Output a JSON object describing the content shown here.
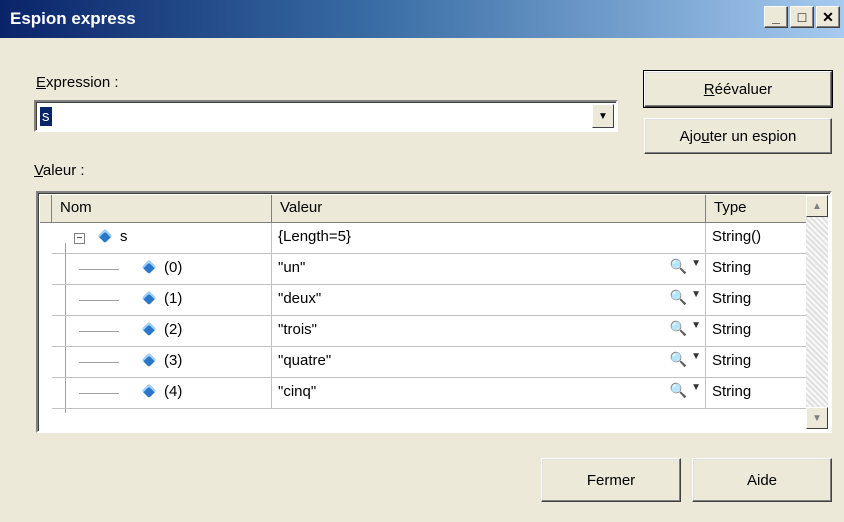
{
  "window": {
    "title": "Espion express",
    "minimize": "_",
    "maximize": "□",
    "close": "✕"
  },
  "expression": {
    "label_prefix": "",
    "label_mnemonic": "E",
    "label_rest": "xpression :",
    "value": "s",
    "dropdown_icon": "chevron-down-icon"
  },
  "buttons": {
    "reevaluate_mnemonic": "R",
    "reevaluate_rest": "éévaluer",
    "add_watch_prefix": "Ajo",
    "add_watch_mnemonic": "u",
    "add_watch_rest": "ter un espion",
    "close": "Fermer",
    "help": "Aide"
  },
  "value_label": {
    "mnemonic": "V",
    "rest": "aleur :"
  },
  "grid": {
    "columns": [
      "Nom",
      "Valeur",
      "Type"
    ],
    "root": {
      "name": "s",
      "value": "{Length=5}",
      "type": "String()"
    },
    "rows": [
      {
        "name": "(0)",
        "value": "\"un\"",
        "type": "String"
      },
      {
        "name": "(1)",
        "value": "\"deux\"",
        "type": "String"
      },
      {
        "name": "(2)",
        "value": "\"trois\"",
        "type": "String"
      },
      {
        "name": "(3)",
        "value": "\"quatre\"",
        "type": "String"
      },
      {
        "name": "(4)",
        "value": "\"cinq\"",
        "type": "String"
      }
    ],
    "toggle": "−"
  }
}
